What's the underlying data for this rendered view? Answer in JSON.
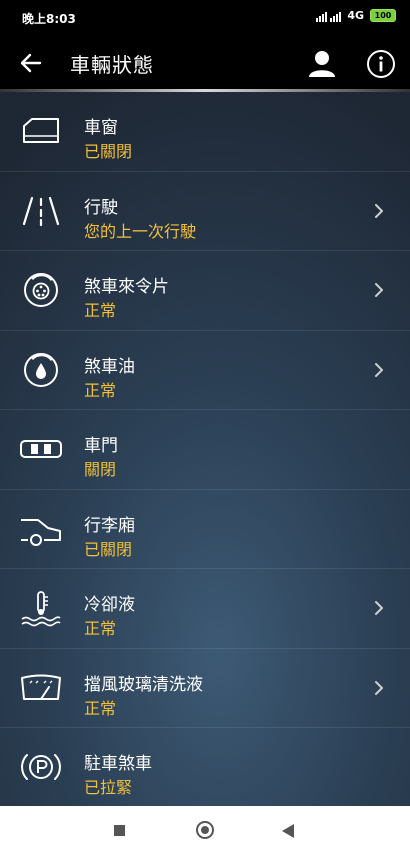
{
  "status_bar": {
    "time": "晚上8:03",
    "network": "4G",
    "battery": "100"
  },
  "header": {
    "title": "車輛狀態"
  },
  "items": [
    {
      "label": "車窗",
      "status": "已關閉",
      "icon": "window-icon",
      "has_chevron": false
    },
    {
      "label": "行駛",
      "status": "您的上一次行駛",
      "icon": "road-icon",
      "has_chevron": true
    },
    {
      "label": "煞車來令片",
      "status": "正常",
      "icon": "brake-pad-icon",
      "has_chevron": true
    },
    {
      "label": "煞車油",
      "status": "正常",
      "icon": "brake-fluid-icon",
      "has_chevron": true
    },
    {
      "label": "車門",
      "status": "關閉",
      "icon": "car-doors-icon",
      "has_chevron": false
    },
    {
      "label": "行李廂",
      "status": "已關閉",
      "icon": "trunk-icon",
      "has_chevron": false
    },
    {
      "label": "冷卻液",
      "status": "正常",
      "icon": "coolant-icon",
      "has_chevron": true
    },
    {
      "label": "擋風玻璃清洗液",
      "status": "正常",
      "icon": "washer-fluid-icon",
      "has_chevron": true
    },
    {
      "label": "駐車煞車",
      "status": "已拉緊",
      "icon": "parking-brake-icon",
      "has_chevron": false
    }
  ],
  "colors": {
    "status_text": "#f2c03a",
    "label_text": "#ffffff"
  }
}
